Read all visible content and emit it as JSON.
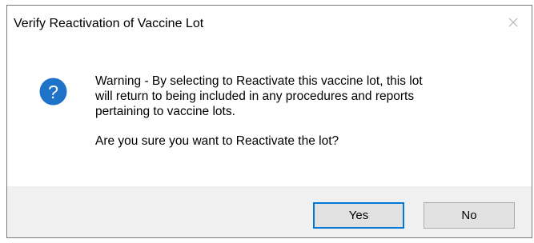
{
  "dialog": {
    "title": "Verify Reactivation of Vaccine Lot",
    "icon": "question-icon",
    "message": "Warning - By selecting to Reactivate this vaccine lot, this lot\nwill return to being included in any procedures and reports\npertaining to vaccine lots.",
    "question": "Are you sure you want to Reactivate the lot?",
    "buttons": {
      "yes": "Yes",
      "no": "No"
    }
  },
  "colors": {
    "icon_blue": "#1e72c8",
    "default_button_border": "#0078d7",
    "footer_bg": "#f0f0f0"
  }
}
